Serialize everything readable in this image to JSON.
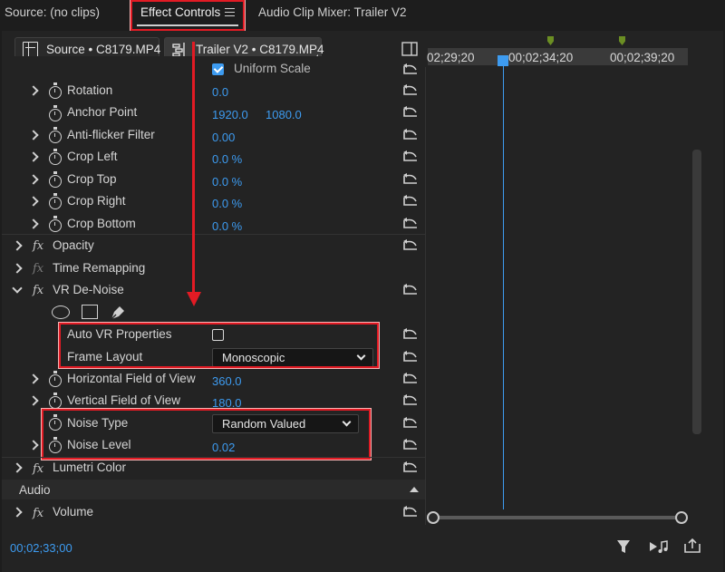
{
  "tabs": {
    "source": "Source: (no clips)",
    "effect_controls": "Effect Controls",
    "audio_mixer": "Audio Clip Mixer: Trailer V2"
  },
  "header": {
    "source_clip": "Source • C8179.MP4",
    "sequence_clip": "Trailer V2 • C8179.MP4"
  },
  "timeline": {
    "ruler_labels": [
      "02;29;20",
      "00;02;34;20",
      "00;02;39;20"
    ],
    "current_time": "00;02;33;00"
  },
  "rows": {
    "uniform_scale": "Uniform Scale",
    "rotation": {
      "label": "Rotation",
      "value": "0.0"
    },
    "anchor_point": {
      "label": "Anchor Point",
      "x": "1920.0",
      "y": "1080.0"
    },
    "anti_flicker": {
      "label": "Anti-flicker Filter",
      "value": "0.00"
    },
    "crop_left": {
      "label": "Crop Left",
      "value": "0.0 %"
    },
    "crop_top": {
      "label": "Crop Top",
      "value": "0.0 %"
    },
    "crop_right": {
      "label": "Crop Right",
      "value": "0.0 %"
    },
    "crop_bottom": {
      "label": "Crop Bottom",
      "value": "0.0 %"
    },
    "opacity": {
      "label": "Opacity"
    },
    "time_remapping": {
      "label": "Time Remapping"
    },
    "vr_denoise": {
      "label": "VR De-Noise"
    },
    "auto_vr": {
      "label": "Auto VR Properties",
      "checked": false
    },
    "frame_layout": {
      "label": "Frame Layout",
      "value": "Monoscopic"
    },
    "h_fov": {
      "label": "Horizontal Field of View",
      "value": "360.0"
    },
    "v_fov": {
      "label": "Vertical Field of View",
      "value": "180.0"
    },
    "noise_type": {
      "label": "Noise Type",
      "value": "Random Valued"
    },
    "noise_level": {
      "label": "Noise Level",
      "value": "0.02"
    },
    "lumetri": {
      "label": "Lumetri Color"
    },
    "audio_section": "Audio",
    "volume": {
      "label": "Volume"
    }
  },
  "fx_symbol": "fx",
  "colors": {
    "accent": "#3d9bf0",
    "highlight": "#e21b24",
    "panel": "#232323",
    "marker": "#6b8e23"
  },
  "icons": [
    "chevron-right-icon",
    "stopwatch-icon",
    "reset-icon",
    "ellipse-mask-icon",
    "rectangle-mask-icon",
    "pen-mask-icon",
    "filter-icon",
    "play-audio-icon",
    "export-icon",
    "panel-toggle-icon"
  ]
}
